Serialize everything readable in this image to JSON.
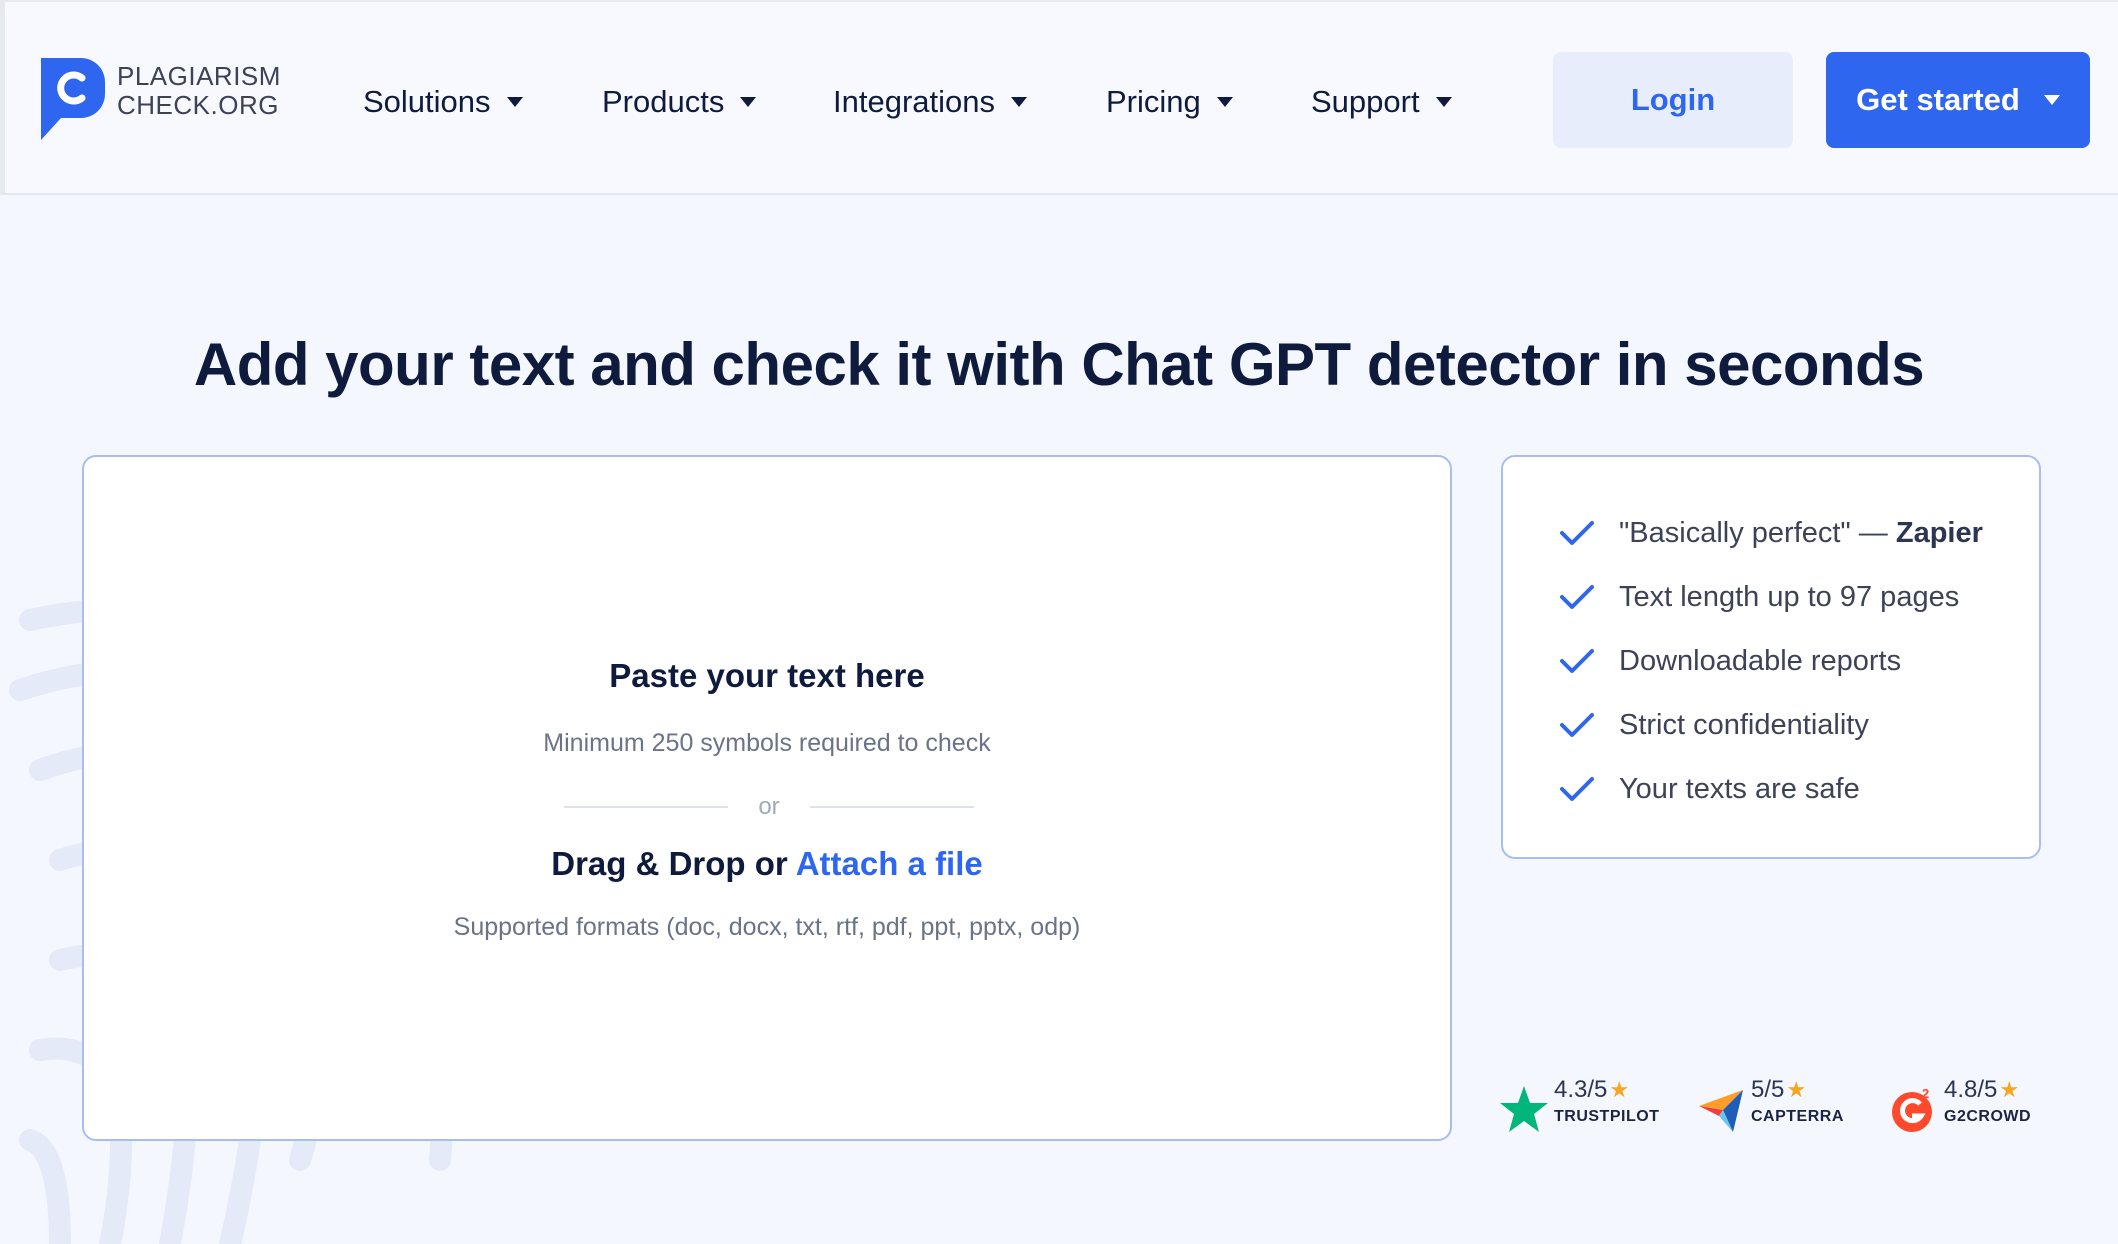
{
  "header": {
    "logo": {
      "line1": "PLAGIARISM",
      "line2": "CHECK.ORG"
    },
    "nav": [
      {
        "label": "Solutions"
      },
      {
        "label": "Products"
      },
      {
        "label": "Integrations"
      },
      {
        "label": "Pricing"
      },
      {
        "label": "Support"
      }
    ],
    "login_label": "Login",
    "get_started_label": "Get started"
  },
  "main": {
    "title": "Add your text and check it with Chat GPT detector in seconds",
    "upload": {
      "paste_title": "Paste your text here",
      "min_text": "Minimum 250 symbols required to check",
      "or_text": "or",
      "drag_text": "Drag & Drop or",
      "attach_link": "Attach a file",
      "formats_text": "Supported formats (doc, docx, txt, rtf, pdf, ppt, pptx, odp)"
    },
    "features": [
      {
        "text": "\"Basically perfect\" — ",
        "bold": "Zapier"
      },
      {
        "text": "Text length up to 97 pages"
      },
      {
        "text": "Downloadable reports"
      },
      {
        "text": "Strict confidentiality"
      },
      {
        "text": "Your texts are safe"
      }
    ],
    "ratings": [
      {
        "score": "4.3/5",
        "name": "TRUSTPILOT",
        "icon": "trustpilot-star-icon"
      },
      {
        "score": "5/5",
        "name": "CAPTERRA",
        "icon": "capterra-icon"
      },
      {
        "score": "4.8/5",
        "name": "G2CROWD",
        "icon": "g2-icon"
      }
    ]
  },
  "colors": {
    "accent": "#2f66f0",
    "title": "#0f1b3d",
    "background": "#f4f7fd",
    "star": "#f5a623",
    "trustpilot": "#00b67a"
  }
}
